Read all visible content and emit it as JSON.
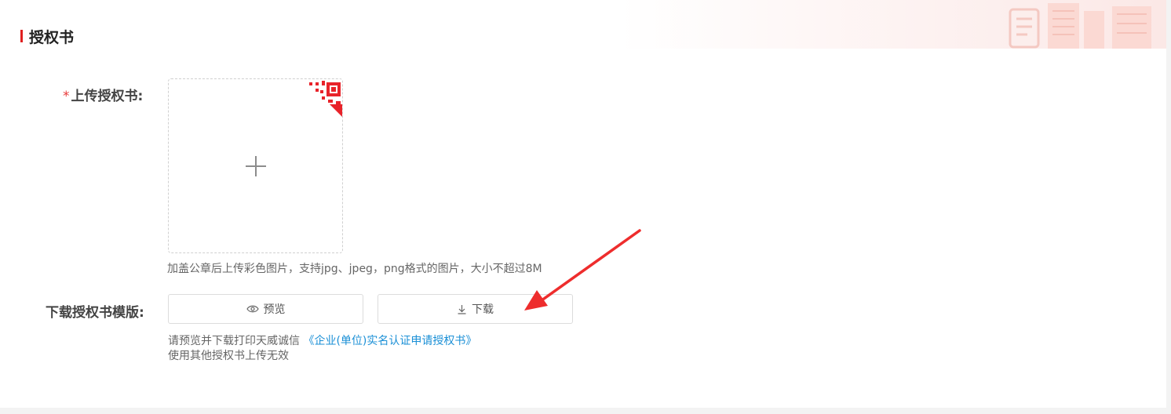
{
  "section": {
    "title": "授权书"
  },
  "upload": {
    "required_mark": "*",
    "label": "上传授权书:",
    "hint": "加盖公章后上传彩色图片，支持jpg、jpeg，png格式的图片，大小不超过8M"
  },
  "template": {
    "label": "下载授权书模版:",
    "preview_label": "预览",
    "download_label": "下载",
    "note_prefix": "请预览并下载打印天威诚信 ",
    "note_link": "《企业(单位)实名认证申请授权书》",
    "note_line2": "使用其他授权书上传无效"
  },
  "colors": {
    "accent": "#e02020",
    "link": "#1a8fd6",
    "annotation_arrow": "#ee2d2d"
  }
}
